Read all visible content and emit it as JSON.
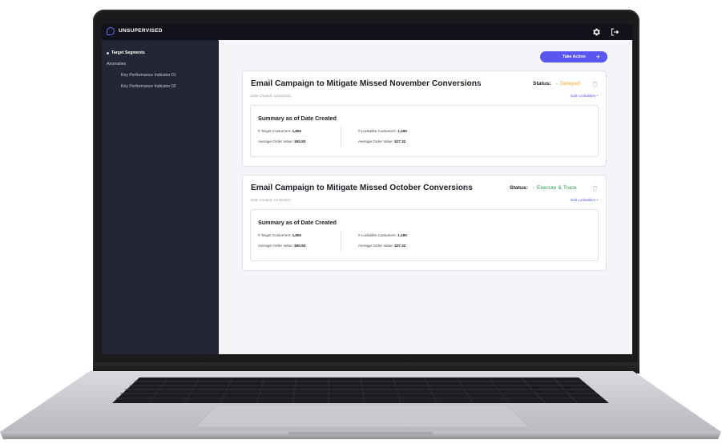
{
  "app": {
    "brand": "UNSUPERVISED"
  },
  "sidebar": {
    "items": [
      {
        "label": "Target Segments",
        "active": true
      },
      {
        "label": "Anomalies",
        "active": false
      },
      {
        "label": "Key Performance Indicator 01",
        "active": false
      },
      {
        "label": "Key Performance Indicator 02",
        "active": false
      }
    ]
  },
  "toolbar": {
    "take_action_label": "Take Action",
    "take_action_icon": "plus-icon"
  },
  "campaigns": [
    {
      "title": "Email Campaign to Mitigate Missed November Conversions",
      "date_created": "Date Created: 12/15/2021",
      "status_label": "Status:",
      "status_value": "Delayed",
      "status_color": "#f5a623",
      "edit_link": "Edit Lookalikes +",
      "summary": {
        "title": "Summary as of Date Created",
        "target_customers_label": "# Target Customers:",
        "target_customers_value": "1,892",
        "aov_label": "Average Order Value:",
        "aov_value": "$50.83",
        "lookalike_customers_label": "# Lookalike Customers:",
        "lookalike_customers_value": "1,180",
        "lookalike_aov_label": "Average Order Value:",
        "lookalike_aov_value": "$27.32"
      }
    },
    {
      "title": "Email Campaign to Mitigate Missed October Conversions",
      "date_created": "Date Created: 11/15/2021",
      "status_label": "Status:",
      "status_value": "Execute & Track",
      "status_color": "#2e9a5a",
      "edit_link": "Edit Lookalikes +",
      "summary": {
        "title": "Summary as of Date Created",
        "target_customers_label": "# Target Customers:",
        "target_customers_value": "1,892",
        "aov_label": "Average Order Value:",
        "aov_value": "$50.83",
        "lookalike_customers_label": "# Lookalike Customers:",
        "lookalike_customers_value": "1,180",
        "lookalike_aov_label": "Average Order Value:",
        "lookalike_aov_value": "$27.32"
      }
    }
  ],
  "colors": {
    "accent": "#5b55f2",
    "sidebar_bg": "#242635",
    "topbar_bg": "#12131a"
  }
}
